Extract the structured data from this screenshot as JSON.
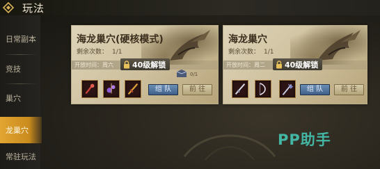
{
  "header": {
    "title": "玩法",
    "back_icon": "diamond-back-icon"
  },
  "sidebar": {
    "items": [
      {
        "label": "日常副本",
        "active": false
      },
      {
        "label": "竞技",
        "active": false
      },
      {
        "label": "巢穴",
        "active": false
      },
      {
        "label": "龙巢穴",
        "active": true
      },
      {
        "label": "常驻玩法",
        "active": false
      }
    ]
  },
  "cards": [
    {
      "title": "海龙巢穴(硬核模式)",
      "remaining_label": "剩余次数：",
      "remaining_value": "1/1",
      "open_time": "开放时间：周六",
      "lock_text": "40级解锁",
      "team_label": "组 队",
      "go_label": "前 往",
      "reward_count": "0/1",
      "items": [
        "red-gem-item",
        "purple-amulet-item",
        "sword-item"
      ]
    },
    {
      "title": "海龙巢穴",
      "remaining_label": "剩余次数：",
      "remaining_value": "1/1",
      "open_time": "开放时间：周二",
      "lock_text": "40级解锁",
      "team_label": "组 队",
      "go_label": "前 往",
      "items": [
        "sword-item",
        "bow-item",
        "axe-item"
      ]
    }
  ],
  "watermark": "PP助手",
  "colors": {
    "active_tab": "#e2a531",
    "team_button": "#4f74a0",
    "go_button": "#c6b98e",
    "watermark": "#43b6a4"
  }
}
